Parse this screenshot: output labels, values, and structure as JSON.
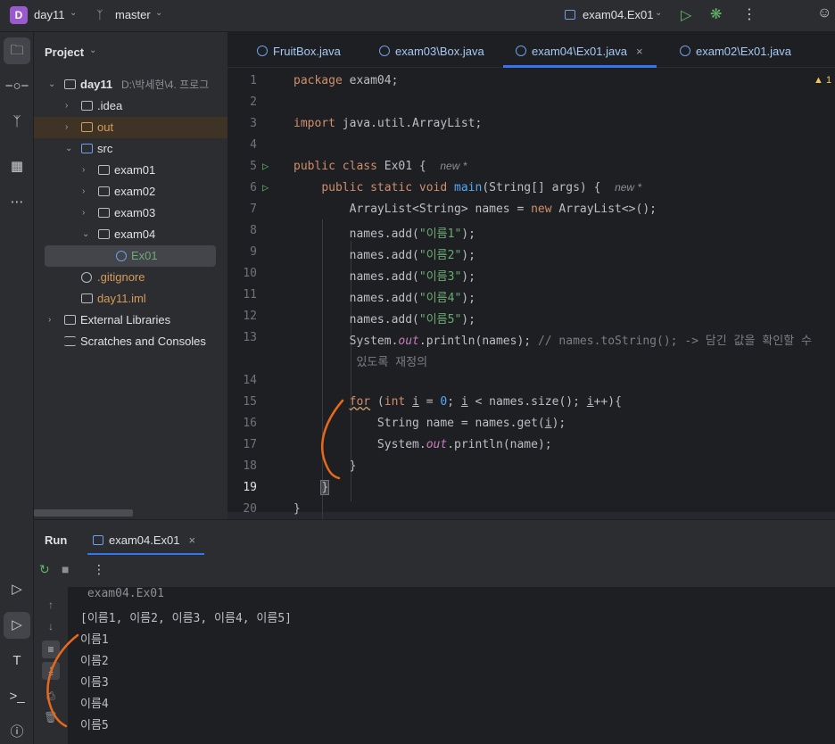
{
  "titlebar": {
    "project_badge": "D",
    "project_name": "day11",
    "branch": "master",
    "run_config": "exam04.Ex01"
  },
  "project_panel": {
    "title": "Project",
    "tree": [
      {
        "label": "day11",
        "path": "D:\\박세현\\4. 프로그",
        "kind": "module",
        "expanded": true
      },
      {
        "label": ".idea",
        "kind": "folder",
        "expanded": false
      },
      {
        "label": "out",
        "kind": "folder-excluded",
        "expanded": false
      },
      {
        "label": "src",
        "kind": "folder-source",
        "expanded": true
      },
      {
        "label": "exam01",
        "kind": "package",
        "expanded": false
      },
      {
        "label": "exam02",
        "kind": "package",
        "expanded": false
      },
      {
        "label": "exam03",
        "kind": "package",
        "expanded": false
      },
      {
        "label": "exam04",
        "kind": "package",
        "expanded": true
      },
      {
        "label": "Ex01",
        "kind": "class",
        "selected": true
      },
      {
        "label": ".gitignore",
        "kind": "file"
      },
      {
        "label": "day11.iml",
        "kind": "file"
      },
      {
        "label": "External Libraries",
        "kind": "library"
      },
      {
        "label": "Scratches and Consoles",
        "kind": "scratch"
      }
    ]
  },
  "editor": {
    "tabs": [
      {
        "label": "FruitBox.java",
        "active": false
      },
      {
        "label": "exam03\\Box.java",
        "active": false
      },
      {
        "label": "exam04\\Ex01.java",
        "active": true
      },
      {
        "label": "exam02\\Ex01.java",
        "active": false
      }
    ],
    "warning_count": "1",
    "line_numbers": [
      "1",
      "2",
      "3",
      "4",
      "5",
      "6",
      "7",
      "8",
      "9",
      "10",
      "11",
      "12",
      "13",
      "14",
      "15",
      "16",
      "17",
      "18",
      "19",
      "20"
    ],
    "inlay_hint": "new *",
    "current_line": "19"
  },
  "run_panel": {
    "title": "Run",
    "tab_label": "exam04.Ex01",
    "output": [
      " exam04.Ex01",
      "[이름1, 이름2, 이름3, 이름4, 이름5]",
      "이름1",
      "이름2",
      "이름3",
      "이름4",
      "이름5"
    ]
  },
  "colors": {
    "accent": "#3574f0",
    "keyword": "#cf8e6d",
    "string": "#6aab73",
    "function": "#56a8f5",
    "static_field": "#c77dbb",
    "annotation_pen": "#e8691b"
  }
}
